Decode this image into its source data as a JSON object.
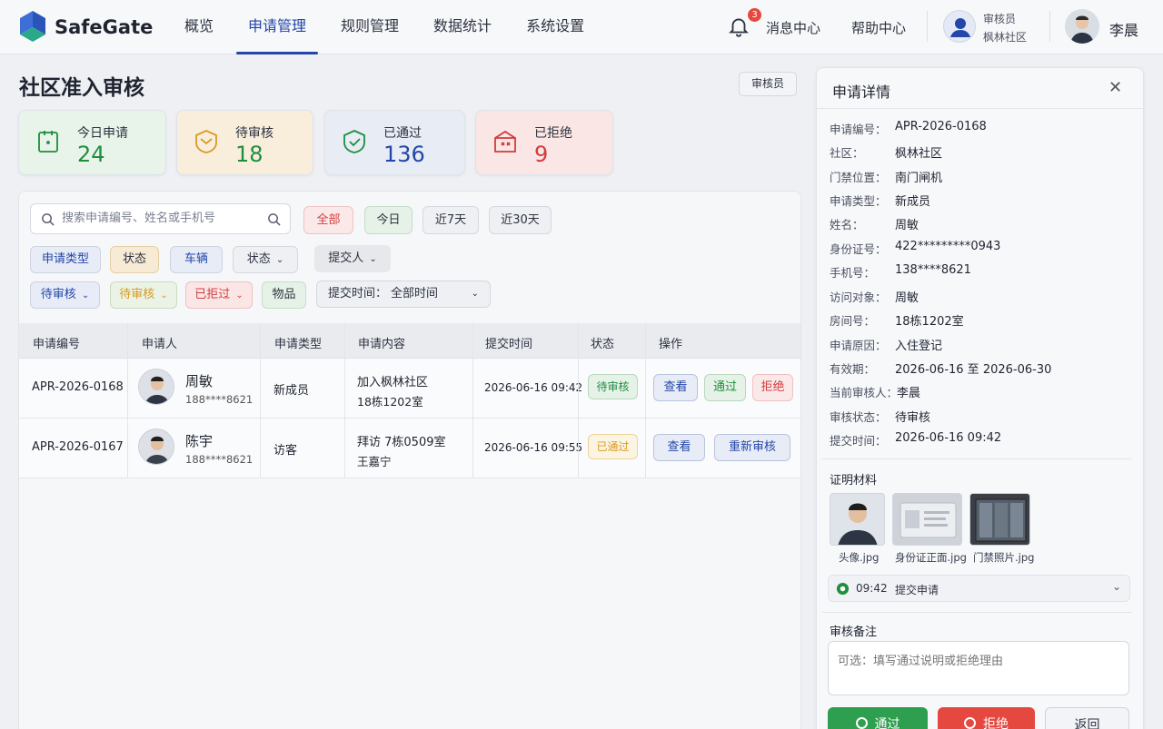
{
  "app": {
    "name": "SafeGate"
  },
  "nav": {
    "items": [
      "概览",
      "申请管理",
      "规则管理",
      "数据统计",
      "系统设置"
    ],
    "active": 1
  },
  "topbar": {
    "notify_count": "3",
    "messages": "消息中心",
    "help": "帮助中心",
    "reviewer_role": "审核员",
    "reviewer_community": "枫林社区",
    "user_name": "李晨"
  },
  "page": {
    "title": "社区准入审核",
    "role_button": "审核员"
  },
  "stats": [
    {
      "label": "今日申请",
      "value": "24",
      "color": "#1e8e3e"
    },
    {
      "label": "待审核",
      "value": "18",
      "color": "#1e8e3e"
    },
    {
      "label": "已通过",
      "value": "136",
      "color": "#2346a8"
    },
    {
      "label": "已拒绝",
      "value": "9",
      "color": "#d13d3d"
    }
  ],
  "filters": {
    "search_placeholder": "搜索申请编号、姓名或手机号",
    "ranges": [
      "全部",
      "今日",
      "近7天",
      "近30天"
    ],
    "row1": [
      "申请类型",
      "状态",
      "车辆",
      "状态",
      "提交人"
    ],
    "row2": [
      "待审核",
      "待审核",
      "已拒过",
      "物品"
    ],
    "time_label": "提交时间：",
    "time_value": "全部时间"
  },
  "table": {
    "headers": [
      "申请编号",
      "申请人",
      "申请类型",
      "申请内容",
      "提交时间",
      "状态",
      "操作"
    ],
    "rows": [
      {
        "id": "APR-2026-0168",
        "name": "周敏",
        "phone": "188****8621",
        "type": "新成员",
        "content1": "加入枫林社区",
        "content2": "18栋1202室",
        "time": "2026-06-16 09:42",
        "status": "待审核",
        "actions": [
          "查看",
          "通过",
          "拒绝"
        ]
      },
      {
        "id": "APR-2026-0167",
        "name": "陈宇",
        "phone": "188****8621",
        "type": "访客",
        "content1": "拜访  7栋0509室",
        "content2": "王嘉宁",
        "time": "2026-06-16 09:55",
        "status": "已通过",
        "actions": [
          "查看",
          "重新审核"
        ]
      }
    ]
  },
  "detail": {
    "title": "申请详情",
    "fields": [
      {
        "k": "申请编号：",
        "v": "APR-2026-0168"
      },
      {
        "k": "社区：",
        "v": "枫林社区"
      },
      {
        "k": "门禁位置：",
        "v": "南门闸机"
      },
      {
        "k": "申请类型：",
        "v": "新成员"
      },
      {
        "k": "姓名：",
        "v": "周敏"
      },
      {
        "k": "身份证号：",
        "v": "422*********0943"
      },
      {
        "k": "手机号：",
        "v": "138****8621"
      },
      {
        "k": "访问对象：",
        "v": "周敏"
      },
      {
        "k": "房间号：",
        "v": "18栋1202室"
      },
      {
        "k": "申请原因：",
        "v": "入住登记"
      },
      {
        "k": "有效期：",
        "v": "2026-06-16 至 2026-06-30"
      },
      {
        "k": "当前审核人：",
        "v": "李晨"
      },
      {
        "k": "审核状态：",
        "v": "待审核"
      },
      {
        "k": "提交时间：",
        "v": "2026-06-16 09:42"
      }
    ],
    "materials_title": "证明材料",
    "materials": [
      "头像.jpg",
      "身份证正面.jpg",
      "门禁照片.jpg"
    ],
    "timeline_time": "09:42",
    "timeline_event": "提交申请",
    "note_title": "审核备注",
    "note_placeholder": "可选：填写通过说明或拒绝理由",
    "approve": "通过",
    "reject": "拒绝",
    "back": "返回"
  }
}
